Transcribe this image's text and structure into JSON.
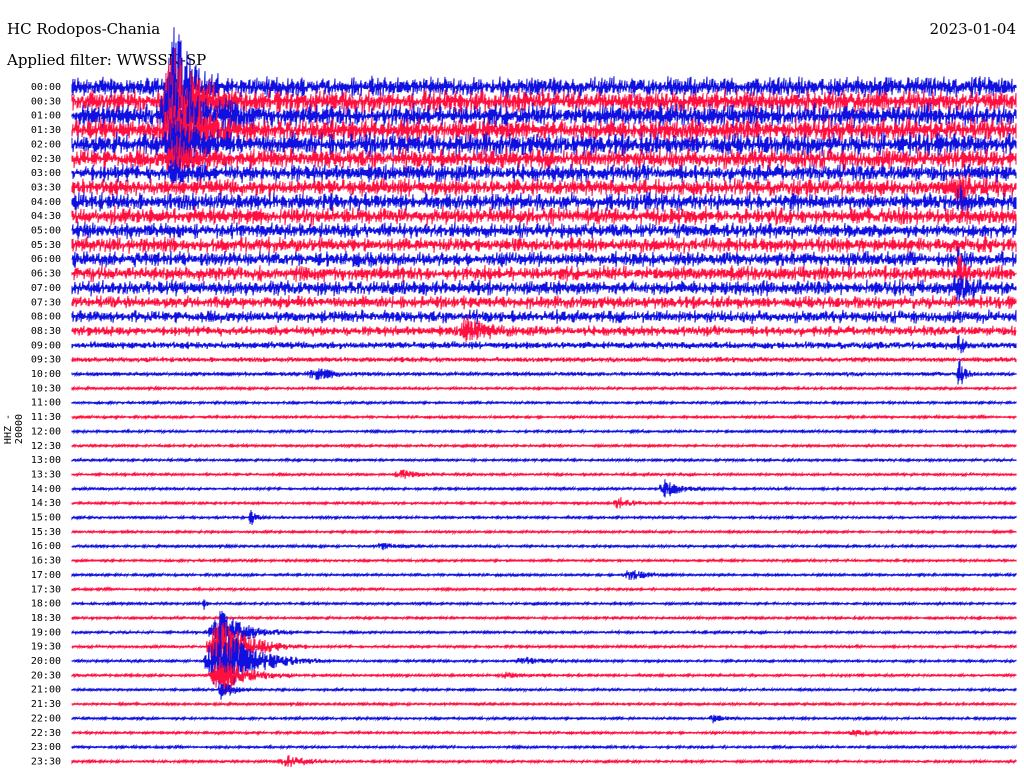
{
  "header": {
    "station": "HC Rodopos-Chania",
    "date": "2023-01-04",
    "filter": "Applied filter: WWSSN-SP"
  },
  "chart_data": {
    "type": "line",
    "title": "HC Rodopos-Chania",
    "channel_label": "HHZ - 20000",
    "row_labels": [
      "00:00",
      "00:30",
      "01:00",
      "01:30",
      "02:00",
      "02:30",
      "03:00",
      "03:30",
      "04:00",
      "04:30",
      "05:00",
      "05:30",
      "06:00",
      "06:30",
      "07:00",
      "07:30",
      "08:00",
      "08:30",
      "09:00",
      "09:30",
      "10:00",
      "10:30",
      "11:00",
      "11:30",
      "12:00",
      "12:30",
      "13:00",
      "13:30",
      "14:00",
      "14:30",
      "15:00",
      "15:30",
      "16:00",
      "16:30",
      "17:00",
      "17:30",
      "18:00",
      "18:30",
      "19:00",
      "19:30",
      "20:00",
      "20:30",
      "21:00",
      "21:30",
      "22:00",
      "22:30",
      "23:00",
      "23:30"
    ],
    "colors": [
      "#1010e0",
      "#ff1040"
    ],
    "noise_amplitude": [
      8,
      9,
      9,
      9,
      9,
      8,
      7,
      7,
      7,
      7,
      6,
      6,
      6,
      6,
      6,
      5,
      5,
      4,
      3,
      2,
      1.5,
      1,
      1,
      1,
      1,
      1,
      1,
      1,
      1,
      1,
      1,
      1,
      1,
      1,
      1,
      1,
      1,
      1,
      1,
      1,
      1,
      1,
      1,
      1,
      1,
      1,
      1,
      1
    ],
    "events": [
      {
        "row": 0,
        "x": 0.11,
        "amp": 80,
        "width": 0.03
      },
      {
        "row": 1,
        "x": 0.11,
        "amp": 50,
        "width": 0.05
      },
      {
        "row": 2,
        "x": 0.11,
        "amp": 45,
        "width": 0.06
      },
      {
        "row": 3,
        "x": 0.11,
        "amp": 40,
        "width": 0.05
      },
      {
        "row": 4,
        "x": 0.11,
        "amp": 30,
        "width": 0.04
      },
      {
        "row": 5,
        "x": 0.11,
        "amp": 18,
        "width": 0.04
      },
      {
        "row": 6,
        "x": 0.11,
        "amp": 12,
        "width": 0.03
      },
      {
        "row": 7,
        "x": 0.94,
        "amp": 10,
        "width": 0.04
      },
      {
        "row": 8,
        "x": 0.94,
        "amp": 20,
        "width": 0.01
      },
      {
        "row": 12,
        "x": 0.94,
        "amp": 12,
        "width": 0.01
      },
      {
        "row": 13,
        "x": 0.94,
        "amp": 20,
        "width": 0.01
      },
      {
        "row": 14,
        "x": 0.94,
        "amp": 14,
        "width": 0.02
      },
      {
        "row": 17,
        "x": 0.42,
        "amp": 14,
        "width": 0.03
      },
      {
        "row": 18,
        "x": 0.94,
        "amp": 10,
        "width": 0.01
      },
      {
        "row": 20,
        "x": 0.94,
        "amp": 18,
        "width": 0.01
      },
      {
        "row": 20,
        "x": 0.26,
        "amp": 6,
        "width": 0.04
      },
      {
        "row": 27,
        "x": 0.35,
        "amp": 5,
        "width": 0.03
      },
      {
        "row": 28,
        "x": 0.63,
        "amp": 9,
        "width": 0.03
      },
      {
        "row": 29,
        "x": 0.58,
        "amp": 6,
        "width": 0.03
      },
      {
        "row": 30,
        "x": 0.19,
        "amp": 9,
        "width": 0.01
      },
      {
        "row": 32,
        "x": 0.33,
        "amp": 3,
        "width": 0.03
      },
      {
        "row": 34,
        "x": 0.59,
        "amp": 7,
        "width": 0.03
      },
      {
        "row": 36,
        "x": 0.14,
        "amp": 6,
        "width": 0.005
      },
      {
        "row": 38,
        "x": 0.16,
        "amp": 22,
        "width": 0.05
      },
      {
        "row": 39,
        "x": 0.16,
        "amp": 30,
        "width": 0.06
      },
      {
        "row": 40,
        "x": 0.16,
        "amp": 35,
        "width": 0.07
      },
      {
        "row": 40,
        "x": 0.48,
        "amp": 4,
        "width": 0.04
      },
      {
        "row": 41,
        "x": 0.16,
        "amp": 20,
        "width": 0.05
      },
      {
        "row": 41,
        "x": 0.46,
        "amp": 3,
        "width": 0.03
      },
      {
        "row": 42,
        "x": 0.16,
        "amp": 12,
        "width": 0.02
      },
      {
        "row": 44,
        "x": 0.68,
        "amp": 4,
        "width": 0.02
      },
      {
        "row": 45,
        "x": 0.83,
        "amp": 3,
        "width": 0.03
      },
      {
        "row": 47,
        "x": 0.23,
        "amp": 6,
        "width": 0.04
      }
    ]
  }
}
